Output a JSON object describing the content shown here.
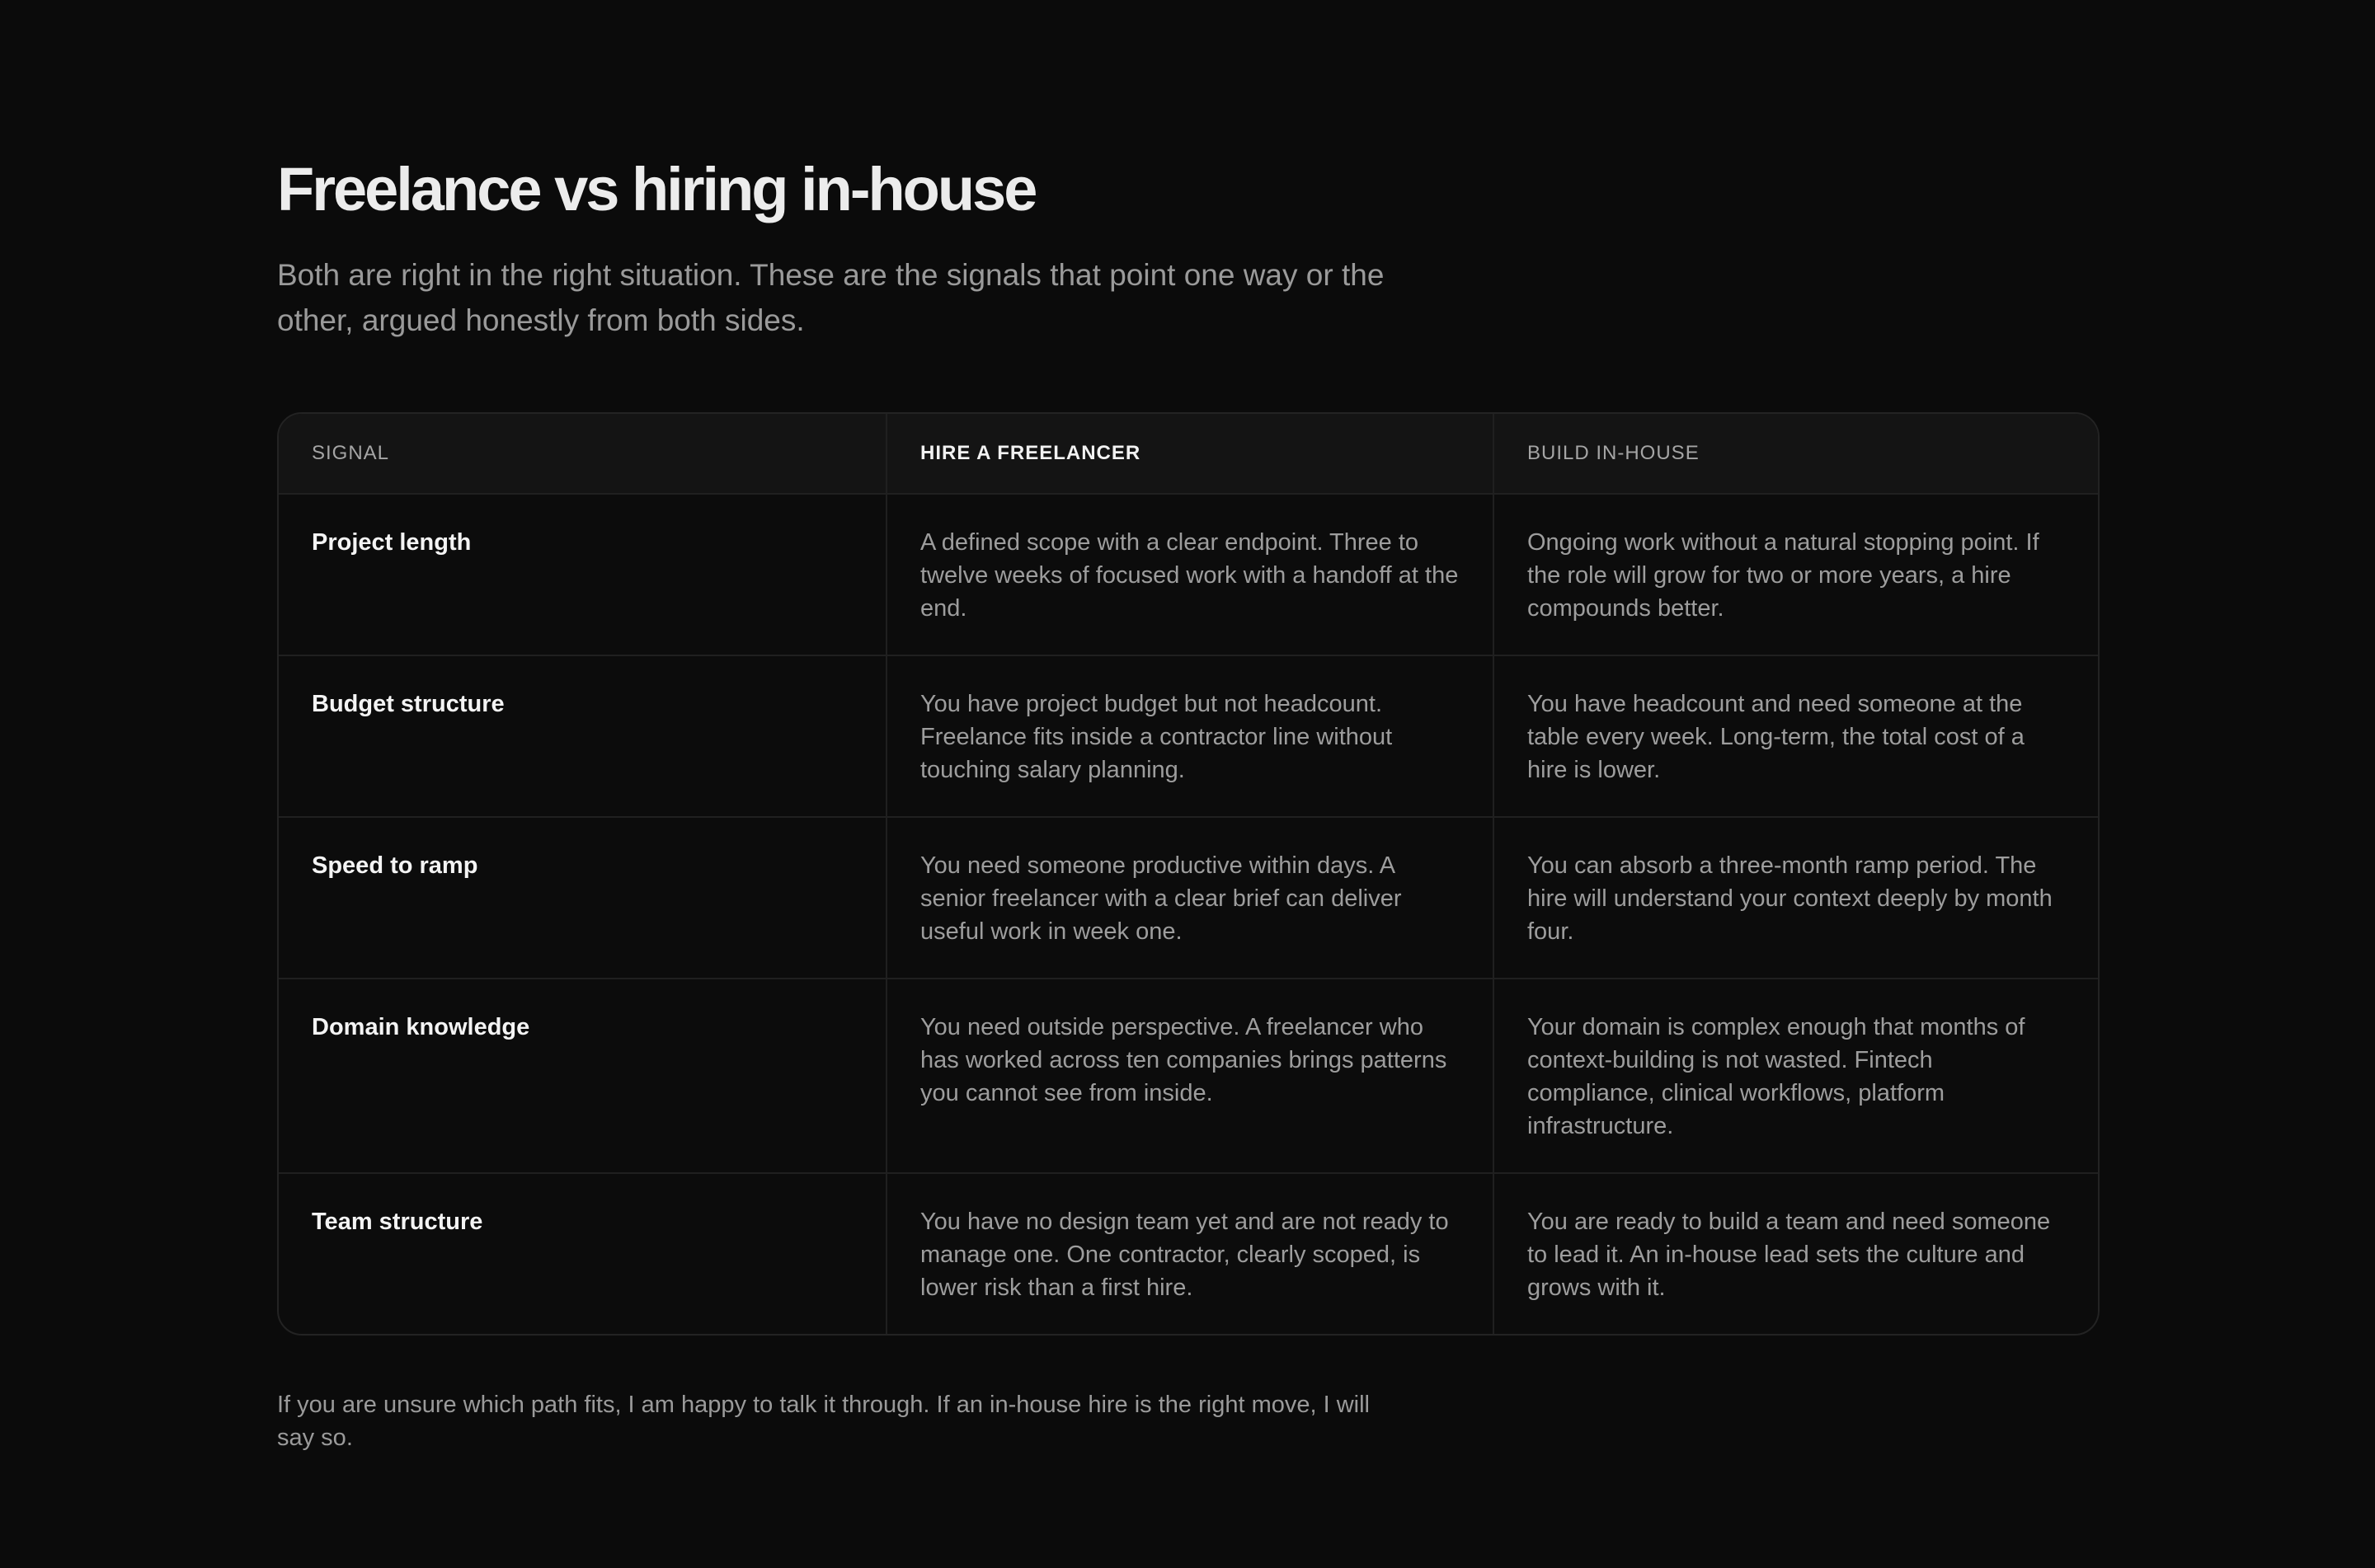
{
  "heading": {
    "title": "Freelance vs hiring in-house",
    "subtitle": "Both are right in the right situation. These are the signals that point one way or the other, argued honestly from both sides."
  },
  "table": {
    "columns": [
      "SIGNAL",
      "HIRE A FREELANCER",
      "BUILD IN-HOUSE"
    ],
    "rows": [
      {
        "signal": "Project length",
        "freelancer": "A defined scope with a clear endpoint. Three to twelve weeks of focused work with a handoff at the end.",
        "inhouse": "Ongoing work without a natural stopping point. If the role will grow for two or more years, a hire compounds better."
      },
      {
        "signal": "Budget structure",
        "freelancer": "You have project budget but not headcount. Freelance fits inside a contractor line without touching salary planning.",
        "inhouse": "You have headcount and need someone at the table every week. Long-term, the total cost of a hire is lower."
      },
      {
        "signal": "Speed to ramp",
        "freelancer": "You need someone productive within days. A senior freelancer with a clear brief can deliver useful work in week one.",
        "inhouse": "You can absorb a three-month ramp period. The hire will understand your context deeply by month four."
      },
      {
        "signal": "Domain knowledge",
        "freelancer": "You need outside perspective. A freelancer who has worked across ten companies brings patterns you cannot see from inside.",
        "inhouse": "Your domain is complex enough that months of context-building is not wasted. Fintech compliance, clinical workflows, platform infrastructure."
      },
      {
        "signal": "Team structure",
        "freelancer": "You have no design team yet and are not ready to manage one. One contractor, clearly scoped, is lower risk than a first hire.",
        "inhouse": "You are ready to build a team and need someone to lead it. An in-house lead sets the culture and grows with it."
      }
    ]
  },
  "footer": {
    "note": "If you are unsure which path fits, I am happy to talk it through. If an in-house hire is the right move, I will say so."
  }
}
